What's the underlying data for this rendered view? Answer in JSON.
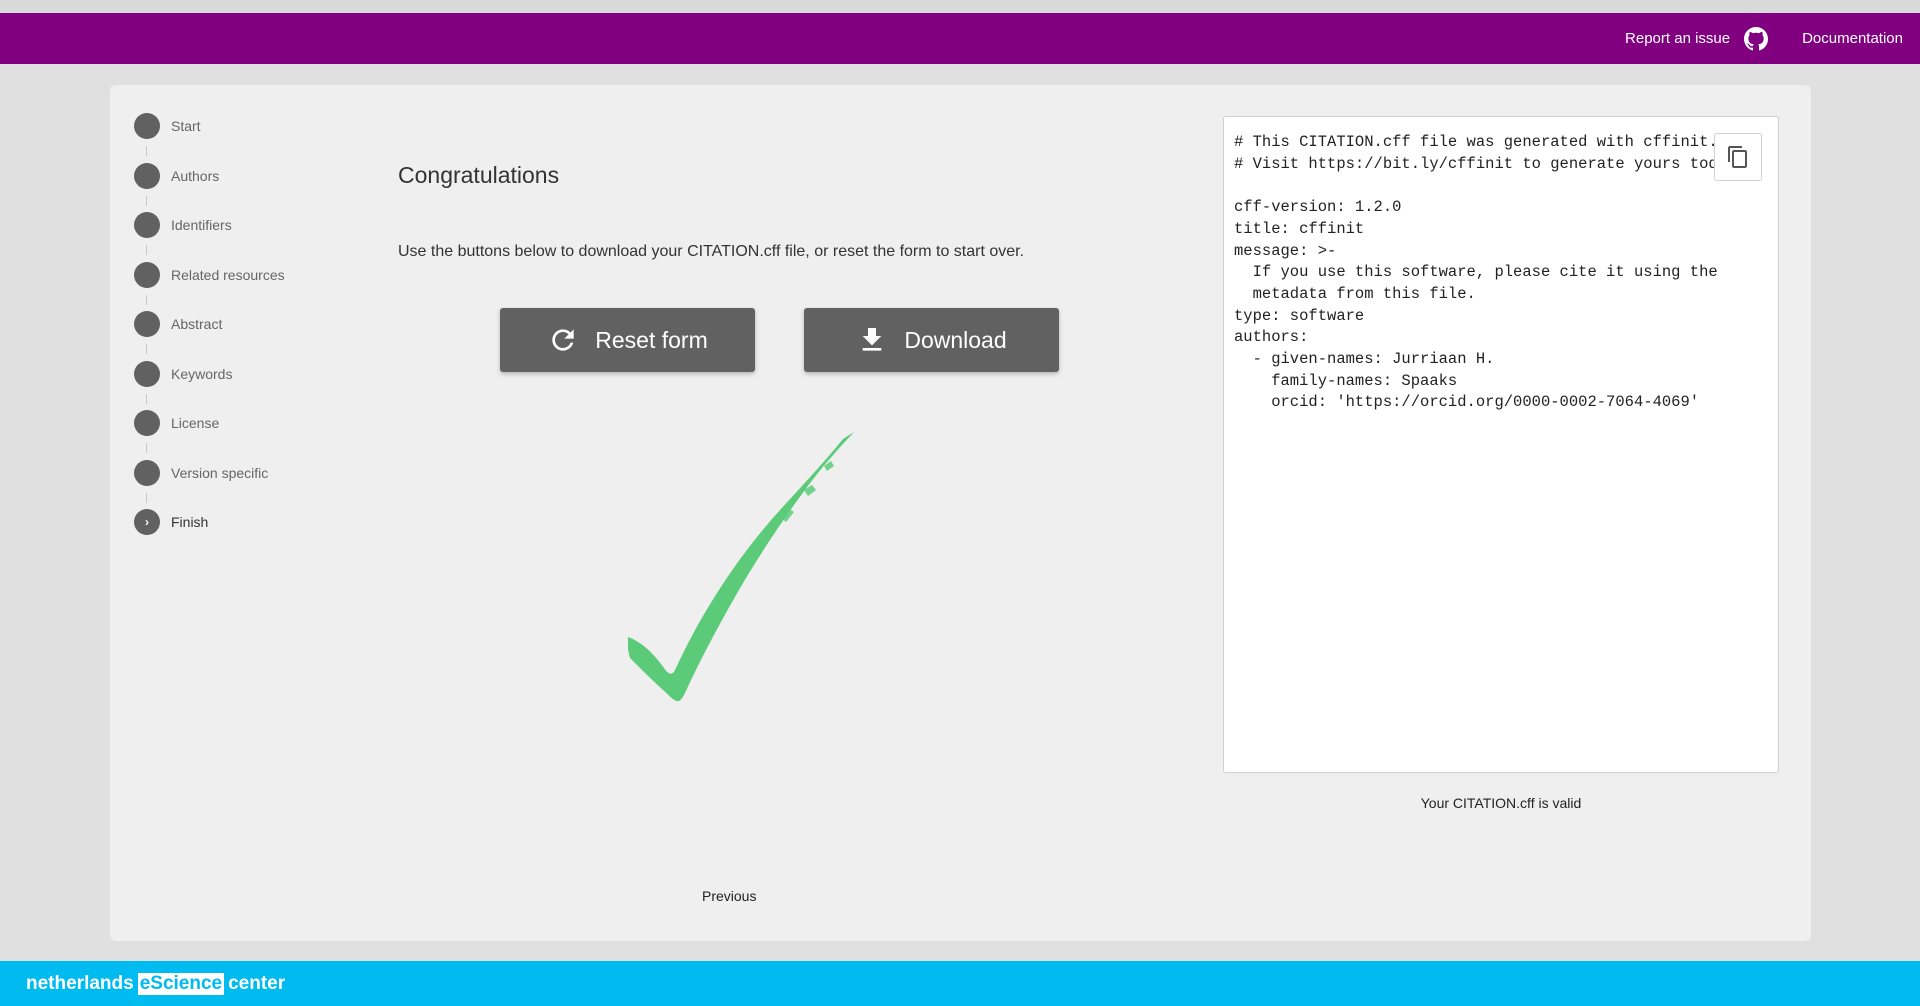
{
  "header": {
    "report_issue": "Report an issue",
    "documentation": "Documentation"
  },
  "stepper": {
    "steps": [
      {
        "label": "Start"
      },
      {
        "label": "Authors"
      },
      {
        "label": "Identifiers"
      },
      {
        "label": "Related resources"
      },
      {
        "label": "Abstract"
      },
      {
        "label": "Keywords"
      },
      {
        "label": "License"
      },
      {
        "label": "Version specific"
      },
      {
        "label": "Finish",
        "marker": "›"
      }
    ]
  },
  "main": {
    "title": "Congratulations",
    "description": "Use the buttons below to download your CITATION.cff file, or reset the form to start over.",
    "reset_label": "Reset form",
    "download_label": "Download",
    "previous_label": "Previous"
  },
  "preview": {
    "code": "# This CITATION.cff file was generated with cffinit.\n# Visit https://bit.ly/cffinit to generate yours today!\n\ncff-version: 1.2.0\ntitle: cffinit\nmessage: >-\n  If you use this software, please cite it using the\n  metadata from this file.\ntype: software\nauthors:\n  - given-names: Jurriaan H.\n    family-names: Spaaks\n    orcid: 'https://orcid.org/0000-0002-7064-4069'",
    "validity": "Your CITATION.cff is valid"
  },
  "footer": {
    "logo_left": "netherlands",
    "logo_mid": "eScience",
    "logo_right": "center"
  },
  "colors": {
    "header": "#800080",
    "footer": "#00bbf0",
    "button": "#616161",
    "check": "#5ccb79"
  }
}
